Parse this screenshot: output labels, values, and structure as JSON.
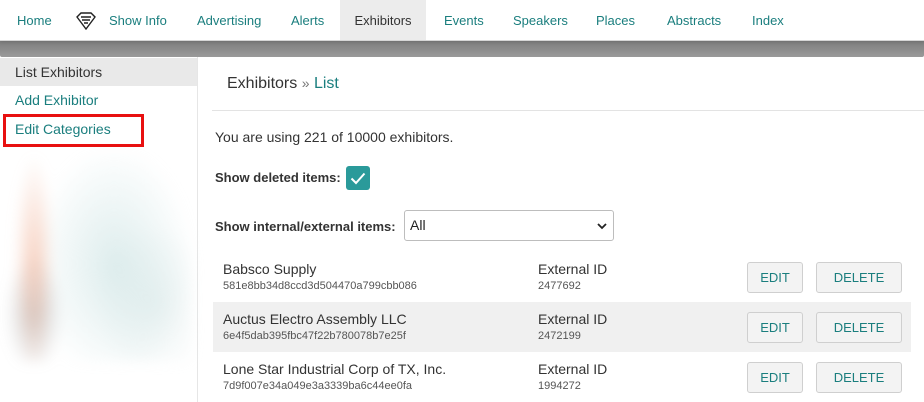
{
  "nav": {
    "items": [
      {
        "label": "Home",
        "active": false
      },
      {
        "label": "Show Info",
        "active": false
      },
      {
        "label": "Advertising",
        "active": false
      },
      {
        "label": "Alerts",
        "active": false
      },
      {
        "label": "Exhibitors",
        "active": true
      },
      {
        "label": "Events",
        "active": false
      },
      {
        "label": "Speakers",
        "active": false
      },
      {
        "label": "Places",
        "active": false
      },
      {
        "label": "Abstracts",
        "active": false
      },
      {
        "label": "Index",
        "active": false
      }
    ],
    "logo_icon": "superman-shield-icon"
  },
  "sidebar": {
    "header": "List Exhibitors",
    "links": [
      "Add Exhibitor",
      "Edit Categories"
    ]
  },
  "breadcrumb": {
    "parent": "Exhibitors",
    "separator": "»",
    "current": "List"
  },
  "usage_text": "You are using 221 of 10000 exhibitors.",
  "filters": {
    "show_deleted_label": "Show deleted items:",
    "show_deleted_checked": true,
    "internal_external_label": "Show internal/external items:",
    "internal_external_value": "All"
  },
  "buttons": {
    "edit": "EDIT",
    "delete": "DELETE"
  },
  "rows": [
    {
      "name": "Babsco Supply",
      "hash": "581e8bb34d8ccd3d504470a799cbb086",
      "ext_label": "External ID",
      "ext_id": "2477692"
    },
    {
      "name": "Auctus Electro Assembly LLC",
      "hash": "6e4f5dab395fbc47f22b780078b7e25f",
      "ext_label": "External ID",
      "ext_id": "2472199"
    },
    {
      "name": "Lone Star Industrial Corp of TX, Inc.",
      "hash": "7d9f007e34a049e3a3339ba6c44ee0fa",
      "ext_label": "External ID",
      "ext_id": "1994272"
    }
  ],
  "colors": {
    "accent": "#1a7e7e",
    "checkbox": "#2a9a9a",
    "highlight": "#e81010"
  }
}
